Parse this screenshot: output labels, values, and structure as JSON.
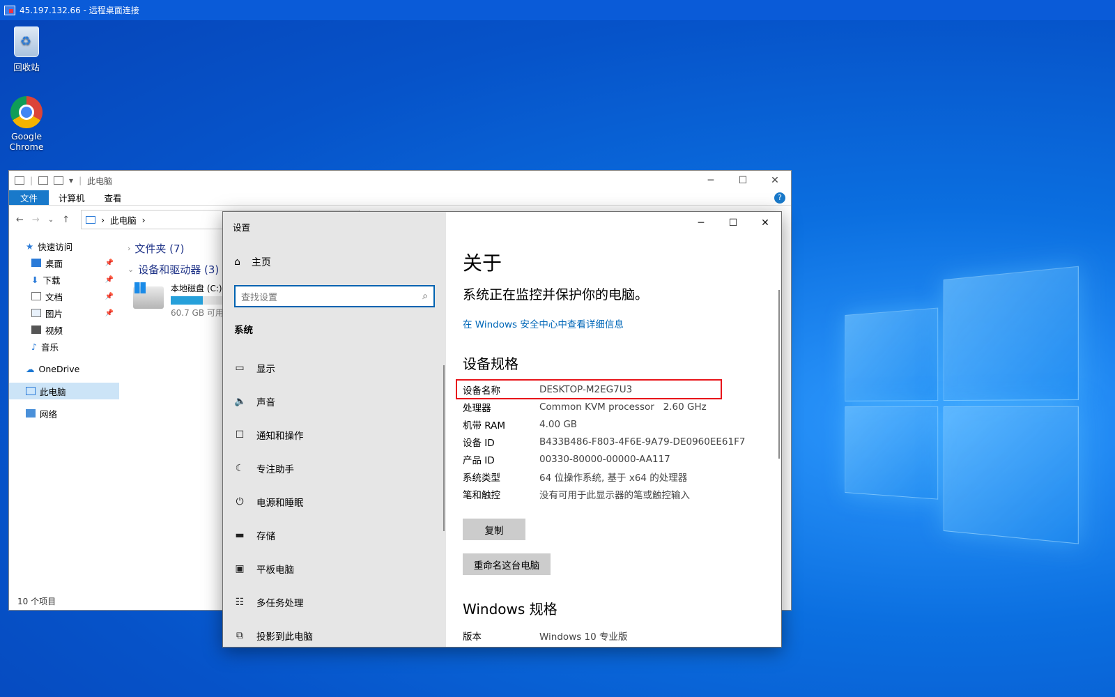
{
  "rdp": {
    "title": "45.197.132.66 - 远程桌面连接"
  },
  "desktop": {
    "icons": [
      {
        "label": "回收站"
      },
      {
        "label": "Google Chrome"
      }
    ]
  },
  "explorer": {
    "title": "此电脑",
    "tabs": [
      "文件",
      "计算机",
      "查看"
    ],
    "breadcrumb": "此电脑",
    "nav": {
      "quick_access": "快速访问",
      "desktop": "桌面",
      "downloads": "下载",
      "documents": "文档",
      "pictures": "图片",
      "videos": "视频",
      "music": "音乐",
      "onedrive": "OneDrive",
      "this_pc": "此电脑",
      "network": "网络"
    },
    "groups": {
      "folders": "文件夹 (7)",
      "devices": "设备和驱动器 (3)"
    },
    "drive": {
      "name": "本地磁盘 (C:)",
      "free": "60.7 GB 可用",
      "used_fraction": 0.6
    },
    "status": "10 个项目"
  },
  "settings": {
    "title": "设置",
    "home": "主页",
    "search_placeholder": "查找设置",
    "section": "系统",
    "menu": [
      "显示",
      "声音",
      "通知和操作",
      "专注助手",
      "电源和睡眠",
      "存储",
      "平板电脑",
      "多任务处理",
      "投影到此电脑"
    ],
    "about_heading": "关于",
    "protect_text": "系统正在监控并保护你的电脑。",
    "security_link": "在 Windows 安全中心中查看详细信息",
    "device_spec_heading": "设备规格",
    "specs": [
      {
        "k": "设备名称",
        "v": "DESKTOP-M2EG7U3"
      },
      {
        "k": "处理器",
        "v": "Common KVM processor   2.60 GHz"
      },
      {
        "k": "机带 RAM",
        "v": "4.00 GB"
      },
      {
        "k": "设备 ID",
        "v": "B433B486-F803-4F6E-9A79-DE0960EE61F7"
      },
      {
        "k": "产品 ID",
        "v": "00330-80000-00000-AA117"
      },
      {
        "k": "系统类型",
        "v": "64 位操作系统, 基于 x64 的处理器"
      },
      {
        "k": "笔和触控",
        "v": "没有可用于此显示器的笔或触控输入"
      }
    ],
    "copy_button": "复制",
    "rename_button": "重命名这台电脑",
    "windows_spec_heading": "Windows 规格",
    "edition": {
      "k": "版本",
      "v": "Windows 10 专业版"
    }
  },
  "colors": {
    "accent": "#0067b8",
    "highlight_box": "#e8141a"
  }
}
